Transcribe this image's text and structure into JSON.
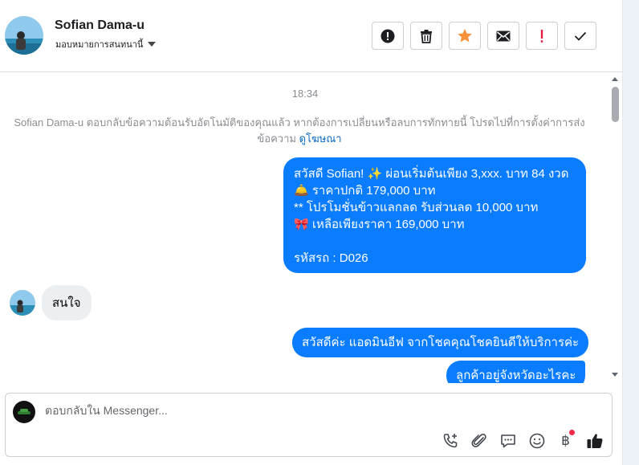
{
  "header": {
    "contact_name": "Sofian Dama-u",
    "assign_label": "มอบหมายการสนทนานี้",
    "actions": [
      {
        "name": "report-spam-icon",
        "label": "!"
      },
      {
        "name": "trash-icon",
        "label": ""
      },
      {
        "name": "star-icon",
        "label": ""
      },
      {
        "name": "mail-icon",
        "label": ""
      },
      {
        "name": "important-icon",
        "label": "!"
      },
      {
        "name": "done-check-icon",
        "label": ""
      }
    ],
    "colors": {
      "star": "#f7923b",
      "important": "#e41e3f"
    }
  },
  "conversation": {
    "timestamp": "18:34",
    "system_note": "Sofian Dama-u ตอบกลับข้อความต้อนรับอัตโนมัติของคุณแล้ว หากต้องการเปลี่ยนหรือลบการทักทายนี้ โปรดไปที่การตั้งค่าการส่งข้อความ",
    "system_note_link": "ดูโฆษณา",
    "messages": [
      {
        "from": "page",
        "text": "สวัสดี Sofian! ✨  ผ่อนเริ่มต้นเพียง 3,xxx. บาท 84 งวด\n🛎️ ราคาปกติ 179,000 บาท\n** โปรโมชั่นข้าวแลกลด รับส่วนลด 10,000 บาท\n🎀  เหลือเพียงราคา 169,000 บาท\n\n รหัสรถ : D026"
      },
      {
        "from": "customer",
        "text": "สนใจ"
      },
      {
        "from": "page",
        "text": "สวัสดีค่ะ แอดมินอีฟ จากโชคคุณโชคยินดีให้บริการค่ะ"
      },
      {
        "from": "page",
        "text": "ลูกค้าอยู่จังหวัดอะไรคะ"
      }
    ],
    "colors": {
      "outgoing": "#0a7cff",
      "incoming": "#eceff2"
    }
  },
  "composer": {
    "placeholder": "ตอบกลับใน Messenger...",
    "value": "",
    "tools": [
      "phone-add-icon",
      "paperclip-icon",
      "saved-replies-icon",
      "emoji-icon",
      "baht-payment-icon",
      "thumbs-up-icon"
    ],
    "baht_symbol": "฿"
  }
}
